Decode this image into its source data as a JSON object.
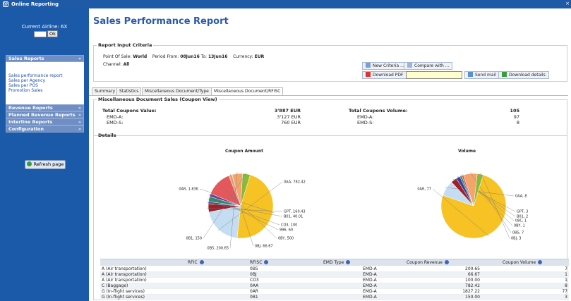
{
  "app": {
    "title": "Online Reporting",
    "icon": "app-logo-icon"
  },
  "sidebar": {
    "airline_label": "Current Airline: 6X",
    "airline_input": "",
    "ok_label": "Ok",
    "sections": [
      {
        "label": "Sales Reports",
        "chevron": "«",
        "links": [
          "Sales performance report",
          "Sales per Agency",
          "Sales per POS",
          "Promotion Sales"
        ]
      },
      {
        "label": "Revenue Reports",
        "chevron": "»"
      },
      {
        "label": "Planned Revenue Reports",
        "chevron": "»"
      },
      {
        "label": "Interline Reports",
        "chevron": "»"
      },
      {
        "label": "Configuration",
        "chevron": "»"
      }
    ],
    "refresh_label": "Refresh page"
  },
  "page": {
    "title": "Sales Performance Report"
  },
  "criteria": {
    "legend": "Report Input Criteria",
    "pos_label": "Point Of Sale:",
    "pos_value": "World",
    "period_label": "Period From:",
    "from": "08Jun16",
    "to_label": "To:",
    "to": "13Jun16",
    "currency_label": "Currency:",
    "currency": "EUR",
    "channel_label": "Channel:",
    "channel": "All",
    "new_criteria": "New Criteria ...",
    "compare": "Compare with ...",
    "download_pdf": "Download PDF",
    "email_value": "",
    "send_mail": "Send mail",
    "download_details": "Download details"
  },
  "tabs": [
    "Summary",
    "Statistics",
    "Miscellaneous Document/Type",
    "Miscellaneous Document/RFISC"
  ],
  "misc": {
    "legend": "Miscellaneous Document Sales (Coupon View)",
    "value_label": "Total Coupons Value:",
    "value_total": "3'887 EUR",
    "value_rows": [
      {
        "label": "EMD-A:",
        "value": "3'127 EUR"
      },
      {
        "label": "EMD-S:",
        "value": "760 EUR"
      }
    ],
    "volume_label": "Total Coupons Volume:",
    "volume_total": "105",
    "volume_rows": [
      {
        "label": "EMD-A:",
        "value": "97"
      },
      {
        "label": "EMD-S:",
        "value": "8"
      }
    ]
  },
  "details": {
    "legend": "Details"
  },
  "chart_data": [
    {
      "type": "pie",
      "title": "Coupon Amount",
      "slices": [
        {
          "label": "0AR, 1.83K",
          "value": 1827.22,
          "color": "#f6c224"
        },
        {
          "label": "0AA, 782.42",
          "value": 782.42,
          "color": "#c5ddf3"
        },
        {
          "label": "GPT, 160.43",
          "value": 160.43,
          "color": "#a02028"
        },
        {
          "label": "B01, 40.01",
          "value": 40.01,
          "color": "#3b3f9a"
        },
        {
          "label": "CO3, 100",
          "value": 100,
          "color": "#2e8a6e"
        },
        {
          "label": "996, 60",
          "value": 60,
          "color": "#6a3d8e"
        },
        {
          "label": "0BY, 500",
          "value": 500,
          "color": "#e4575a"
        },
        {
          "label": "0BJ, 66.67",
          "value": 66.67,
          "color": "#f0aa80"
        },
        {
          "label": "0B5, 200.65",
          "value": 200.65,
          "color": "#f2a46b"
        },
        {
          "label": "0B1, 150",
          "value": 150,
          "color": "#8ab93a"
        }
      ]
    },
    {
      "type": "pie",
      "title": "Volume",
      "slices": [
        {
          "label": "0AR, 77",
          "value": 77,
          "color": "#f6c224"
        },
        {
          "label": "0AA, 8",
          "value": 8,
          "color": "#c5ddf3"
        },
        {
          "label": "GPT, 3",
          "value": 3,
          "color": "#a02028"
        },
        {
          "label": "B01, 2",
          "value": 2,
          "color": "#3b3f9a"
        },
        {
          "label": "08C, 1",
          "value": 1,
          "color": "#2e8a6e"
        },
        {
          "label": "0BY, 1",
          "value": 1,
          "color": "#e4575a"
        },
        {
          "label": "0B5, 7",
          "value": 7,
          "color": "#f2a46b"
        },
        {
          "label": "0BJ, 3",
          "value": 3,
          "color": "#8ab93a"
        }
      ]
    }
  ],
  "table": {
    "headers": [
      "RFIC",
      "RFISC",
      "EMD Type",
      "Coupon Revenue",
      "Coupon Volume"
    ],
    "rows": [
      [
        "A (Air transportation)",
        "0B5",
        "EMD-A",
        "200.65",
        "7"
      ],
      [
        "A (Air transportation)",
        "0BJ",
        "EMD-A",
        "66.67",
        "1"
      ],
      [
        "A (Air transportation)",
        "CO3",
        "EMD-A",
        "100.00",
        "1"
      ],
      [
        "C (Baggage)",
        "0AA",
        "EMD-A",
        "782.42",
        "8"
      ],
      [
        "G (In-flight services)",
        "0AR",
        "EMD-A",
        "1827.22",
        "77"
      ],
      [
        "G (In-flight services)",
        "0B1",
        "EMD-A",
        "150.00",
        "3"
      ]
    ]
  }
}
